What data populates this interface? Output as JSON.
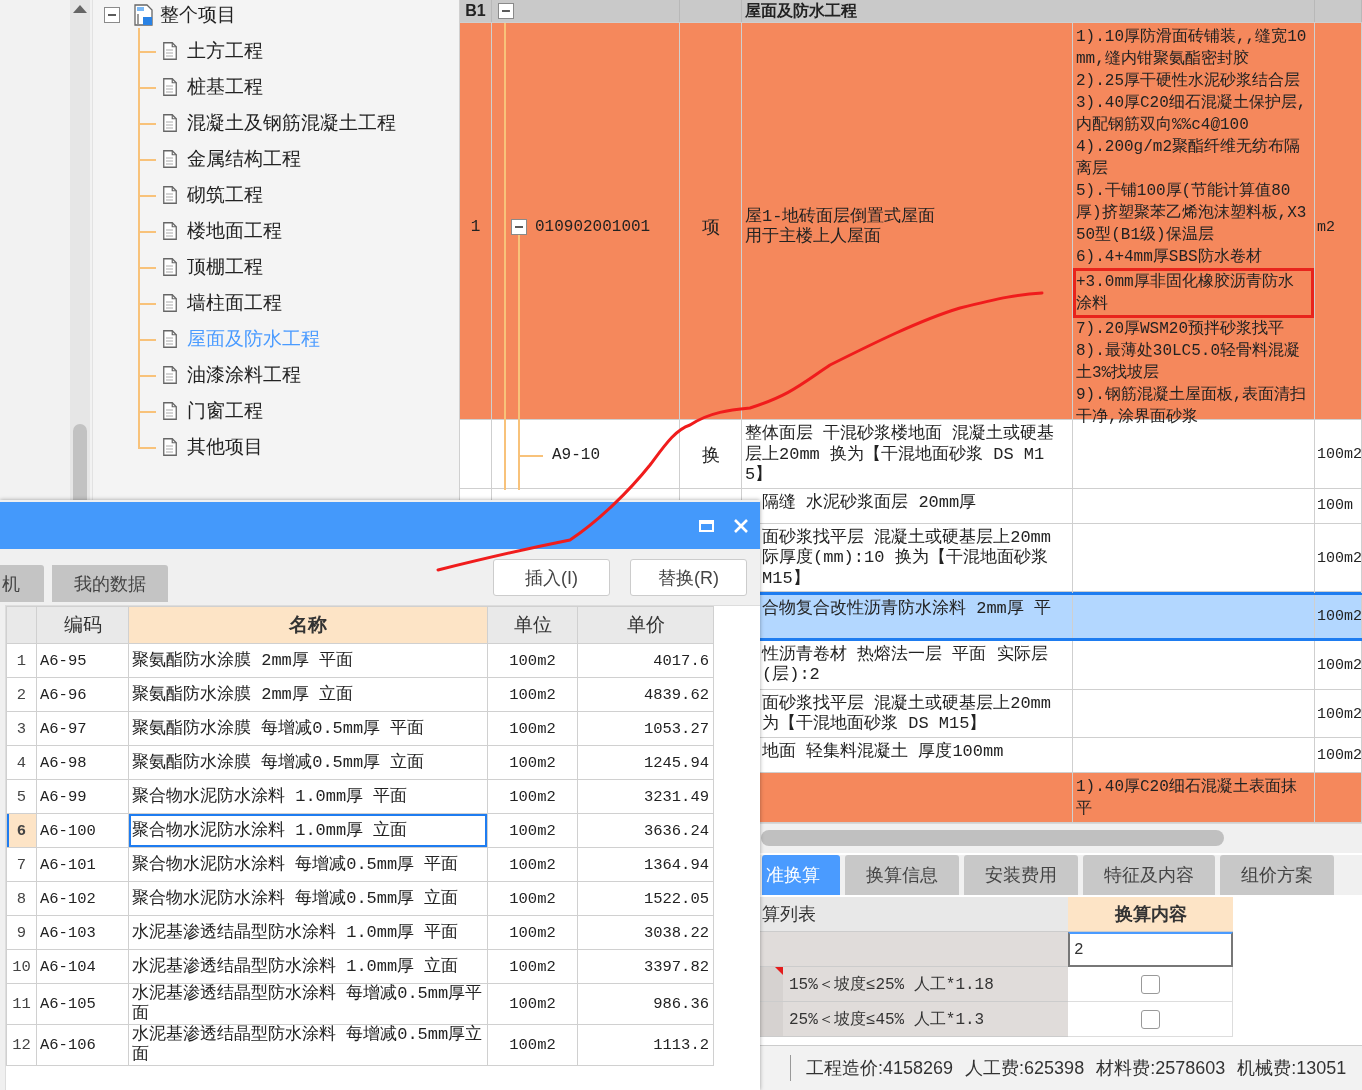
{
  "tree": {
    "label": "整个项目",
    "expanded": true,
    "children": [
      {
        "label": "土方工程",
        "selected": false
      },
      {
        "label": "桩基工程",
        "selected": false
      },
      {
        "label": "混凝土及钢筋混凝土工程",
        "selected": false
      },
      {
        "label": "金属结构工程",
        "selected": false
      },
      {
        "label": "砌筑工程",
        "selected": false
      },
      {
        "label": "楼地面工程",
        "selected": false
      },
      {
        "label": "顶棚工程",
        "selected": false
      },
      {
        "label": "墙柱面工程",
        "selected": false
      },
      {
        "label": "屋面及防水工程",
        "selected": true
      },
      {
        "label": "油漆涂料工程",
        "selected": false
      },
      {
        "label": "门窗工程",
        "selected": false
      },
      {
        "label": "其他项目",
        "selected": false
      }
    ]
  },
  "grid": {
    "header": {
      "number": "B1",
      "expanded": true,
      "title": "屋面及防水工程"
    },
    "rows": [
      {
        "kind": "bill",
        "number": "1",
        "expanded": true,
        "code": "010902001001",
        "type": "项",
        "name": "屋1-地砖面层倒置式屋面用于主楼上人屋面",
        "features": [
          {
            "text": "1).10厚防滑面砖铺装,,缝宽10mm,缝内钳聚氨酯密封胶",
            "circled": false
          },
          {
            "text": "2).25厚干硬性水泥砂浆结合层",
            "circled": false
          },
          {
            "text": "3).40厚C20细石混凝土保护层,内配钢筋双向%%c4@100",
            "circled": false
          },
          {
            "text": "4).200g/m2聚酯纤维无纺布隔离层",
            "circled": false
          },
          {
            "text": "5).干铺100厚(节能计算值80厚)挤塑聚苯乙烯泡沫塑料板,X350型(B1级)保温层",
            "circled": false
          },
          {
            "text": "6).4+4mm厚SBS防水卷材",
            "circled": false
          },
          {
            "text": "+3.0mm厚非固化橡胶沥青防水涂料",
            "circled": true
          },
          {
            "text": "7).20厚WSM20预拌砂浆找平",
            "circled": false
          },
          {
            "text": "8).最薄处30LC5.0轻骨料混凝土3%找坡层",
            "circled": false
          },
          {
            "text": "9).钢筋混凝土屋面板,表面清扫干净,涂界面砂浆",
            "circled": false
          }
        ],
        "unit": "m2",
        "selected": false
      },
      {
        "kind": "norm",
        "code": "A9-10",
        "type": "换",
        "name": "整体面层 干混砂浆楼地面 混凝土或硬基层上20mm  换为【干混地面砂浆 DS M15】",
        "unit": "100m2",
        "selected": false
      },
      {
        "kind": "norm",
        "name": "隔缝 水泥砂浆面层 20mm厚",
        "unit": "100m",
        "selected": false
      },
      {
        "kind": "norm",
        "name": "面砂浆找平层 混凝土或硬基层上20mm\n际厚度(mm):10  换为【干混地面砂浆\nM15】",
        "unit": "100m2",
        "selected": false
      },
      {
        "kind": "norm",
        "name": "合物复合改性沥青防水涂料 2mm厚 平",
        "unit": "100m2",
        "selected": true
      },
      {
        "kind": "norm",
        "name": "性沥青卷材 热熔法一层 平面  实际层\n(层):2",
        "unit": "100m2",
        "selected": false
      },
      {
        "kind": "norm",
        "name": "面砂浆找平层 混凝土或硬基层上20mm\n为【干混地面砂浆 DS M15】",
        "unit": "100m2",
        "selected": false
      },
      {
        "kind": "norm",
        "name": "地面 轻集料混凝土 厚度100mm",
        "unit": "100m2",
        "selected": false
      },
      {
        "kind": "bill",
        "features": [
          {
            "text": "1).40厚C20细石混凝土表面抹平",
            "circled": false
          }
        ],
        "selected": false
      }
    ]
  },
  "convert_panel": {
    "tabs": [
      {
        "label": "准换算",
        "selected": true
      },
      {
        "label": "换算信息",
        "selected": false
      },
      {
        "label": "安装费用",
        "selected": false
      },
      {
        "label": "特征及内容",
        "selected": false
      },
      {
        "label": "组价方案",
        "selected": false
      }
    ],
    "columns": [
      {
        "label": "算列表",
        "active": false
      },
      {
        "label": "换算内容",
        "active": true
      }
    ],
    "value": "2",
    "rows": [
      {
        "label": "15%＜坡度≤25% 人工*1.18",
        "flagged": true,
        "checked": false
      },
      {
        "label": "25%＜坡度≤45% 人工*1.3",
        "flagged": false,
        "checked": false
      }
    ]
  },
  "status_bar": [
    "工程造价:4158269",
    "人工费:625398",
    "材料费:2578603",
    "机械费:13051"
  ],
  "dialog": {
    "tabs": [
      {
        "label": "机",
        "selected": false
      },
      {
        "label": "我的数据",
        "selected": false
      }
    ],
    "buttons": [
      "插入(I)",
      "替换(R)"
    ],
    "columns": [
      {
        "label": "编码",
        "active": false
      },
      {
        "label": "名称",
        "active": true
      },
      {
        "label": "单位",
        "active": false
      },
      {
        "label": "单价",
        "active": false
      }
    ],
    "rows": [
      {
        "number": "1",
        "code": "A6-95",
        "name": "聚氨酯防水涂膜 2mm厚 平面",
        "unit": "100m2",
        "price": "4017.6",
        "selected": false
      },
      {
        "number": "2",
        "code": "A6-96",
        "name": "聚氨酯防水涂膜 2mm厚 立面",
        "unit": "100m2",
        "price": "4839.62",
        "selected": false
      },
      {
        "number": "3",
        "code": "A6-97",
        "name": "聚氨酯防水涂膜 每增减0.5mm厚 平面",
        "unit": "100m2",
        "price": "1053.27",
        "selected": false
      },
      {
        "number": "4",
        "code": "A6-98",
        "name": "聚氨酯防水涂膜 每增减0.5mm厚 立面",
        "unit": "100m2",
        "price": "1245.94",
        "selected": false
      },
      {
        "number": "5",
        "code": "A6-99",
        "name": "聚合物水泥防水涂料 1.0mm厚 平面",
        "unit": "100m2",
        "price": "3231.49",
        "selected": false
      },
      {
        "number": "6",
        "code": "A6-100",
        "name": "聚合物水泥防水涂料 1.0mm厚 立面",
        "unit": "100m2",
        "price": "3636.24",
        "selected": true
      },
      {
        "number": "7",
        "code": "A6-101",
        "name": "聚合物水泥防水涂料 每增减0.5mm厚 平面",
        "unit": "100m2",
        "price": "1364.94",
        "selected": false
      },
      {
        "number": "8",
        "code": "A6-102",
        "name": "聚合物水泥防水涂料 每增减0.5mm厚 立面",
        "unit": "100m2",
        "price": "1522.05",
        "selected": false
      },
      {
        "number": "9",
        "code": "A6-103",
        "name": "水泥基渗透结晶型防水涂料 1.0mm厚 平面",
        "unit": "100m2",
        "price": "3038.22",
        "selected": false
      },
      {
        "number": "10",
        "code": "A6-104",
        "name": "水泥基渗透结晶型防水涂料 1.0mm厚 立面",
        "unit": "100m2",
        "price": "3397.82",
        "selected": false
      },
      {
        "number": "11",
        "code": "A6-105",
        "name": "水泥基渗透结晶型防水涂料 每增减0.5mm厚平面",
        "unit": "100m2",
        "price": "986.36",
        "selected": false
      },
      {
        "number": "12",
        "code": "A6-106",
        "name": "水泥基渗透结晶型防水涂料 每增减0.5mm厚立面",
        "unit": "100m2",
        "price": "1113.2",
        "selected": false
      }
    ]
  }
}
